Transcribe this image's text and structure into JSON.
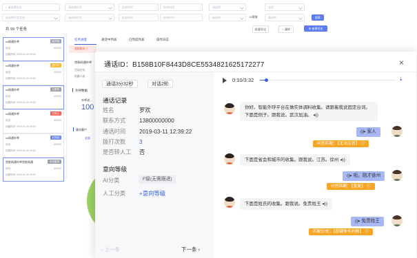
{
  "filters": {
    "row1": [
      "请选择任务",
      "请选择任务",
      "起始时间",
      "结束时间",
      "请选择",
      "全部"
    ],
    "row2": [
      "请选择任务状态",
      "请选择任务",
      "起始时间",
      "结束时间",
      "请选择",
      "请选择"
    ],
    "row2_label": "AI客服",
    "search_button": "搜索"
  },
  "task_bar": {
    "total": "共 99 个任务",
    "import_button": "批量导出",
    "clean_button": "清除",
    "new_task_button": "新建任务"
  },
  "tasks": [
    {
      "title": "xx网通外呼",
      "tag": "未开始",
      "tag_color": "#a3a9b4",
      "status_label": "状态:",
      "status_val": "0/5000",
      "time_label": "创建时间:",
      "time_val": "2019-04-30 09:00"
    },
    {
      "title": "xx网通外呼",
      "tag": "进行中",
      "tag_color": "#f6b935",
      "status_label": "状态:",
      "status_val": "0/5000",
      "time_label": "创建时间:",
      "time_val": "2019-04-30 09:00"
    },
    {
      "title": "xx网通外呼",
      "tag": "已暂停",
      "tag_color": "#9aa0aa",
      "status_label": "状态:",
      "status_val": "0/5000",
      "time_label": "创建时间:",
      "time_val": "2019-04-30 09:00"
    },
    {
      "title": "xx网通外呼",
      "tag": "已停止",
      "tag_color": "#f2675b",
      "status_label": "状态:",
      "status_val": "0/5000",
      "time_label": "创建时间:",
      "time_val": "2019-04-30 09:00"
    },
    {
      "title": "xx网通外呼",
      "tag": "已完成",
      "tag_color": "#6f8bf0",
      "status_label": "状态:",
      "status_val": "0/5000",
      "time_label": "创建时间:",
      "time_val": "2019-04-30 09:00"
    },
    {
      "title": "贷款网通外呼贷款网通",
      "tag": "手动暂停",
      "tag_color": "#9aa0aa",
      "status_label": "状态:",
      "status_val": "0/5000",
      "time_label": "创建时间:",
      "time_val": "2019-04-30 09:00"
    }
  ],
  "bg_tabs": [
    "任务进度",
    "通话中列表",
    "已完成列表",
    "操作日志"
  ],
  "bg": {
    "warning": "流程取消 ①",
    "task_name": "贷款网通外呼",
    "label1": "活动方式:",
    "label2": "机器人送…",
    "section_outbound": "外呼数据",
    "outbound_label": "外呼进…",
    "big_number": "100",
    "section_intent": "意向客户",
    "intent_tab": "全部"
  },
  "modal": {
    "title": "通话ID：B158B10F8443D8CE5534821625172277",
    "duration_badge": "通话3分32秒",
    "turns_badge": "对话2轮",
    "call_record_title": "通话记录",
    "fields": [
      {
        "k": "姓名",
        "v": "罗欢"
      },
      {
        "k": "联系方式",
        "v": "13800000000"
      },
      {
        "k": "通话时间",
        "v": "2019-03-11 12:39:22"
      },
      {
        "k": "拨打次数",
        "v": "3"
      },
      {
        "k": "是否转人工",
        "v": "否"
      }
    ],
    "intent_title": "意向等级",
    "ai_class_label": "AI分类",
    "ai_class_value": "F级(无需跟进)",
    "manual_class_label": "人工分类",
    "manual_class_value": "+意向等级",
    "prev": "上一条",
    "next": "下一条",
    "player_time": "0:10/3:32",
    "player_progress": 0.047
  },
  "chat": [
    {
      "side": "left",
      "text": "你好。智能外呼平台在做实体调料收集。请跟着我说固定台词。下面是例子。跟我说。武汉加油。"
    },
    {
      "side": "right",
      "text": "家人",
      "match": "问答匹配：【无法应答】"
    },
    {
      "side": "left",
      "text": "下面是省会和城市的收集。跟我说。江苏。徐州"
    },
    {
      "side": "right",
      "text": "呃。刚才徐州",
      "match": "问答匹配：【重复】"
    },
    {
      "side": "left",
      "text": "下面是姓氏的收集。跟我说。免贵姓王"
    },
    {
      "side": "right",
      "text": "免贵姓王",
      "match": "匹配分支：【按键条件判断】"
    }
  ]
}
